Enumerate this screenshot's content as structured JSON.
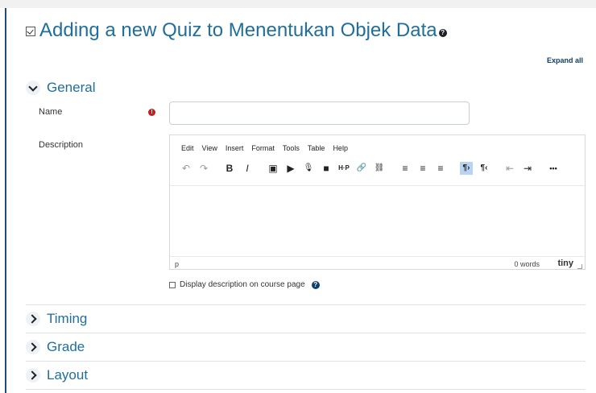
{
  "page": {
    "title": "Adding a new Quiz to Menentukan Objek Data",
    "help_glyph": "?",
    "expand_all": "Expand all"
  },
  "sections": {
    "general": "General",
    "timing": "Timing",
    "grade": "Grade",
    "layout": "Layout"
  },
  "fields": {
    "name_label": "Name",
    "name_value": "",
    "required_glyph": "!",
    "description_label": "Description"
  },
  "editor": {
    "menus": [
      "Edit",
      "View",
      "Insert",
      "Format",
      "Tools",
      "Table",
      "Help"
    ],
    "toolbar_icons": {
      "undo": "↶",
      "redo": "↷",
      "bold": "B",
      "italic": "I",
      "image": "▣",
      "media": "▶",
      "record_audio": "🎙",
      "record_video": "■",
      "h5p": "H·P",
      "link": "🔗",
      "unlink": "⛓",
      "align_left": "≡",
      "align_center": "≡",
      "align_right": "≡",
      "ltr": "¶›",
      "rtl": "¶‹",
      "outdent": "⇤",
      "indent": "⇥",
      "more": "•••"
    },
    "status_path": "p",
    "word_count": "0 words",
    "brand": "tiny"
  },
  "options": {
    "display_description": "Display description on course page"
  }
}
